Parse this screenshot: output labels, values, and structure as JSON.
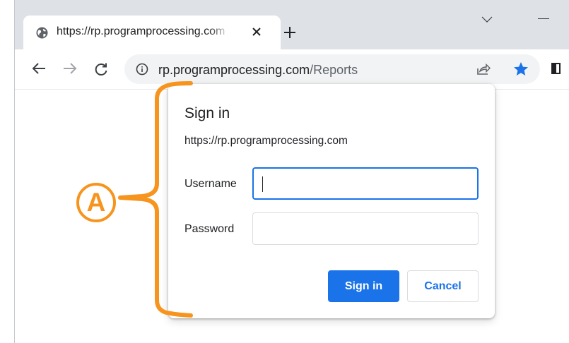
{
  "browser": {
    "tab_title": "https://rp.programprocessing.com",
    "url_host": "rp.programprocessing.com",
    "url_path": "/Reports"
  },
  "dialog": {
    "title": "Sign in",
    "origin": "https://rp.programprocessing.com",
    "username_label": "Username",
    "username_value": "",
    "password_label": "Password",
    "password_value": "",
    "sign_in_button": "Sign in",
    "cancel_button": "Cancel"
  },
  "annotation": {
    "marker_label": "A",
    "color": "#f7941d"
  },
  "colors": {
    "accent": "#1a73e8",
    "tabstrip": "#dee1e6",
    "omnibox": "#f1f3f4"
  }
}
